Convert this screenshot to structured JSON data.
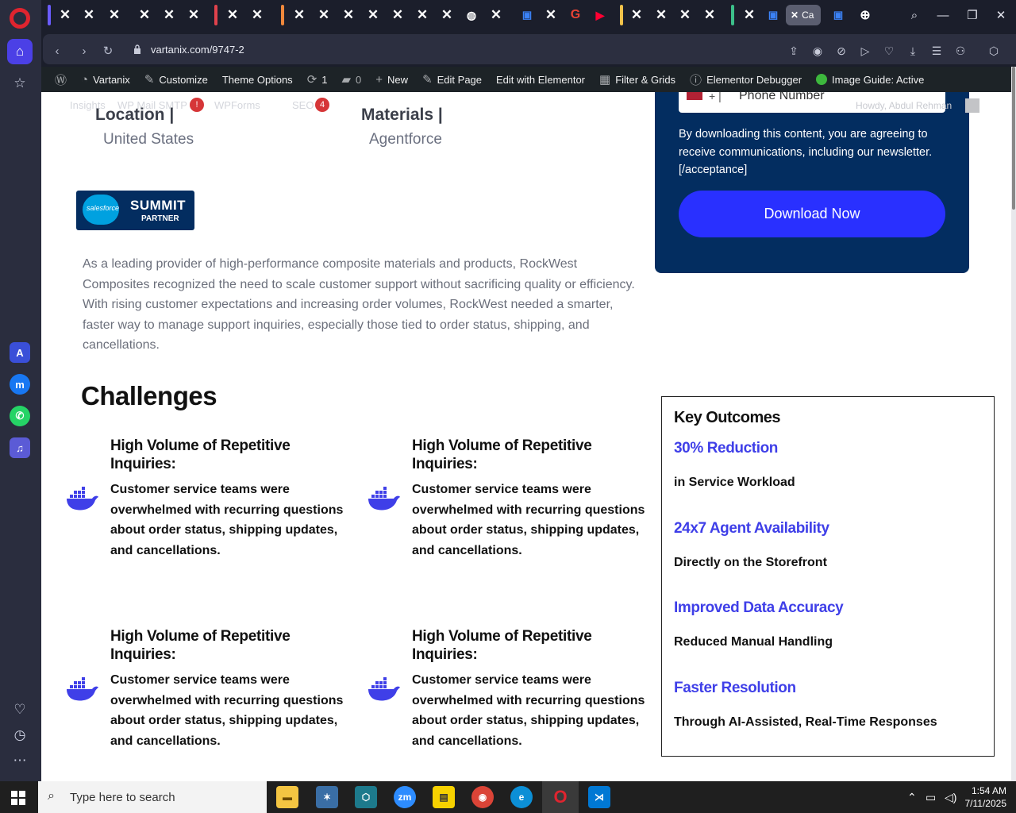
{
  "browser": {
    "url": "vartanix.com/9747-2",
    "active_tab_label": "Ca"
  },
  "wp_bar": {
    "site": "Vartanix",
    "customize": "Customize",
    "theme_options": "Theme Options",
    "updates": "1",
    "comments": "0",
    "new": "New",
    "edit_page": "Edit Page",
    "edit_elementor": "Edit with Elementor",
    "filter_grids": "Filter & Grids",
    "elementor_debugger": "Elementor Debugger",
    "image_guide": "Image Guide: Active"
  },
  "ghost_bar": {
    "insights": "Insights",
    "smtp": "WP Mail SMTP",
    "smtp_badge": "!",
    "wpforms": "WPForms",
    "seo": "SEO",
    "seo_badge": "4",
    "howdy": "Howdy, Abdul Rehman"
  },
  "meta": {
    "location_label": "Location |",
    "location_value": "United States",
    "materials_label": "Materials |",
    "materials_value": "Agentforce"
  },
  "badge": {
    "brand": "salesforce",
    "summit": "SUMMIT",
    "partner": "PARTNER"
  },
  "intro": "As a leading provider of high-performance composite materials and products, RockWest Composites recognized the need to scale customer support without sacrificing quality or efficiency. With rising customer expectations and increasing order volumes, RockWest needed a smarter, faster way to manage support inquiries, especially those tied to order status, shipping, and cancellations.",
  "challenges": {
    "heading": "Challenges",
    "items": [
      {
        "title": "High Volume of Repetitive Inquiries:",
        "desc": "Customer service teams were overwhelmed with recurring questions about order status, shipping updates, and cancellations."
      },
      {
        "title": "High Volume of Repetitive Inquiries:",
        "desc": "Customer service teams were overwhelmed with recurring questions about order status, shipping updates, and cancellations."
      },
      {
        "title": "High Volume of Repetitive Inquiries:",
        "desc": "Customer service teams were overwhelmed with recurring questions about order status, shipping updates, and cancellations."
      },
      {
        "title": "High Volume of Repetitive Inquiries:",
        "desc": "Customer service teams were overwhelmed with recurring questions about order status, shipping updates, and cancellations."
      }
    ]
  },
  "download": {
    "phone_placeholder": "Phone Number",
    "phone_code": "+ |",
    "consent": "By downloading this content, you are agreeing to receive communications, including our newsletter. [/acceptance]",
    "button": "Download Now"
  },
  "outcomes": {
    "title": "Key Outcomes",
    "items": [
      {
        "headline": "30% Reduction",
        "sub": "in Service Workload"
      },
      {
        "headline": "24x7 Agent Availability",
        "sub": "Directly on the Storefront"
      },
      {
        "headline": "Improved Data Accuracy",
        "sub": "Reduced Manual Handling"
      },
      {
        "headline": "Faster Resolution",
        "sub": "Through AI-Assisted, Real-Time Responses"
      }
    ]
  },
  "taskbar": {
    "search_placeholder": "Type here to search",
    "time": "1:54 AM",
    "date": "7/11/2025"
  },
  "colors": {
    "accent_blue": "#3f3fe8",
    "panel_navy": "#032d60",
    "button_blue": "#2930ff"
  }
}
